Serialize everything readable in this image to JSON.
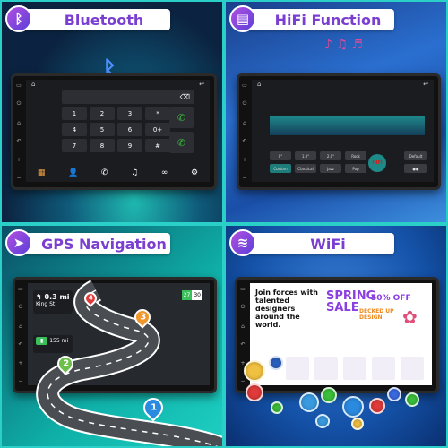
{
  "panels": {
    "bluetooth": {
      "title": "Bluetooth",
      "icon": "bluetooth-icon",
      "keys": [
        "1",
        "2",
        "3",
        "*",
        "4",
        "5",
        "6",
        "0+",
        "7",
        "8",
        "9",
        "#"
      ],
      "dock": [
        "keypad-icon",
        "contacts-icon",
        "call-log-icon",
        "music-icon",
        "link-icon",
        "settings-icon"
      ]
    },
    "hifi": {
      "title": "HiFi Function",
      "icon": "equalizer-icon",
      "presets": [
        "0°",
        "1.0°",
        "2.0°",
        "Rock",
        "Custom",
        "Classical",
        "Jazz",
        "Pop"
      ],
      "badge": "HIFI",
      "right_buttons": [
        "Default",
        "●●"
      ]
    },
    "gps": {
      "title": "GPS Navigation",
      "icon": "navigation-icon",
      "distance": "0.3 mi",
      "street": "King St",
      "remaining": "155 mi",
      "speed": "27",
      "limit": "30",
      "waypoints": [
        "1",
        "2",
        "3",
        "4"
      ]
    },
    "wifi": {
      "title": "WiFi",
      "icon": "wifi-icon",
      "headline": "Join forces with talented designers around the world.",
      "sale": "SPRING SALE",
      "discount": "50% OFF",
      "tagline": "DECKED UP DESIGN"
    }
  },
  "colors": {
    "accent": "#7a3fd0",
    "frame": "#2ad0c8",
    "call": "#3bbf3b"
  }
}
